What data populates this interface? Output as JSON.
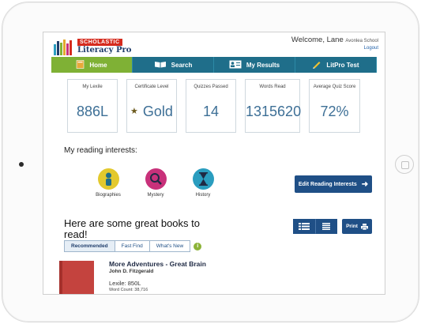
{
  "brand": {
    "publisher": "SCHOLASTIC",
    "product": "Literacy Pro"
  },
  "user": {
    "welcome": "Welcome, Lane",
    "school": "Avonlea School",
    "logout": "Logout"
  },
  "nav": [
    {
      "label": "Home",
      "icon": "book-icon"
    },
    {
      "label": "Search",
      "icon": "open-book-icon"
    },
    {
      "label": "My Results",
      "icon": "results-icon"
    },
    {
      "label": "LitPro Test",
      "icon": "pencil-icon"
    }
  ],
  "stats": [
    {
      "label": "My Lexile",
      "value": "886L"
    },
    {
      "label": "Certificate Level",
      "value": "Gold"
    },
    {
      "label": "Quizzes Passed",
      "value": "14"
    },
    {
      "label": "Words Read",
      "value": "1315620"
    },
    {
      "label": "Average Quiz Score",
      "value": "72%"
    }
  ],
  "interests": {
    "title": "My reading interests:",
    "items": [
      {
        "label": "Biographies",
        "color": "#e3c92d",
        "icon": "person-icon"
      },
      {
        "label": "Mystery",
        "color": "#c8317a",
        "icon": "magnifier-icon"
      },
      {
        "label": "History",
        "color": "#2a9dbf",
        "icon": "hourglass-icon"
      }
    ],
    "edit_label": "Edit Reading Interests"
  },
  "books": {
    "title": "Here are some great books to read!",
    "tabs": [
      "Recommended",
      "Fast Find",
      "What's New"
    ],
    "info": "i",
    "print_label": "Print",
    "items": [
      {
        "title": "More Adventures - Great Brain",
        "author": "John D. Fitzgerald",
        "lexile": "Lexile: 850L",
        "word_count": "Word Count: 38,716"
      }
    ]
  },
  "colors": {
    "nav_blue": "#1f6e8a",
    "nav_green": "#7fb135",
    "button_navy": "#1f4f86",
    "stat_blue": "#3d6f96"
  }
}
